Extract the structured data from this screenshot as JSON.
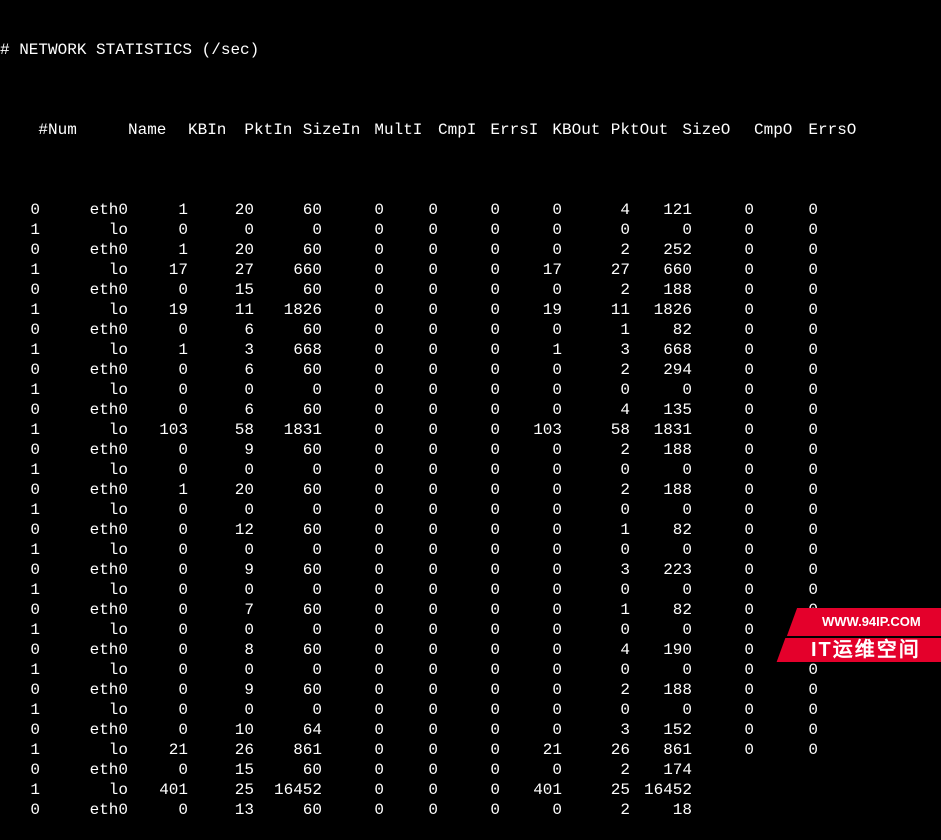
{
  "title": "# NETWORK STATISTICS (/sec)",
  "headers": {
    "num": "#Num",
    "name": "Name",
    "kbin": "KBIn",
    "pktin": "PktIn",
    "sizein": "SizeIn",
    "multi": "MultI",
    "cmpi": "CmpI",
    "errsi": "ErrsI",
    "kbout": "KBOut",
    "pktout": "PktOut",
    "sizeo": "SizeO",
    "cmpo": "CmpO",
    "errso": "ErrsO"
  },
  "rows": [
    {
      "num": "0",
      "name": "eth0",
      "kbin": "1",
      "pktin": "20",
      "sizein": "60",
      "multi": "0",
      "cmpi": "0",
      "errsi": "0",
      "kbout": "0",
      "pktout": "4",
      "sizeo": "121",
      "cmpo": "0",
      "errso": "0"
    },
    {
      "num": "1",
      "name": "lo",
      "kbin": "0",
      "pktin": "0",
      "sizein": "0",
      "multi": "0",
      "cmpi": "0",
      "errsi": "0",
      "kbout": "0",
      "pktout": "0",
      "sizeo": "0",
      "cmpo": "0",
      "errso": "0"
    },
    {
      "num": "0",
      "name": "eth0",
      "kbin": "1",
      "pktin": "20",
      "sizein": "60",
      "multi": "0",
      "cmpi": "0",
      "errsi": "0",
      "kbout": "0",
      "pktout": "2",
      "sizeo": "252",
      "cmpo": "0",
      "errso": "0"
    },
    {
      "num": "1",
      "name": "lo",
      "kbin": "17",
      "pktin": "27",
      "sizein": "660",
      "multi": "0",
      "cmpi": "0",
      "errsi": "0",
      "kbout": "17",
      "pktout": "27",
      "sizeo": "660",
      "cmpo": "0",
      "errso": "0"
    },
    {
      "num": "0",
      "name": "eth0",
      "kbin": "0",
      "pktin": "15",
      "sizein": "60",
      "multi": "0",
      "cmpi": "0",
      "errsi": "0",
      "kbout": "0",
      "pktout": "2",
      "sizeo": "188",
      "cmpo": "0",
      "errso": "0"
    },
    {
      "num": "1",
      "name": "lo",
      "kbin": "19",
      "pktin": "11",
      "sizein": "1826",
      "multi": "0",
      "cmpi": "0",
      "errsi": "0",
      "kbout": "19",
      "pktout": "11",
      "sizeo": "1826",
      "cmpo": "0",
      "errso": "0"
    },
    {
      "num": "0",
      "name": "eth0",
      "kbin": "0",
      "pktin": "6",
      "sizein": "60",
      "multi": "0",
      "cmpi": "0",
      "errsi": "0",
      "kbout": "0",
      "pktout": "1",
      "sizeo": "82",
      "cmpo": "0",
      "errso": "0"
    },
    {
      "num": "1",
      "name": "lo",
      "kbin": "1",
      "pktin": "3",
      "sizein": "668",
      "multi": "0",
      "cmpi": "0",
      "errsi": "0",
      "kbout": "1",
      "pktout": "3",
      "sizeo": "668",
      "cmpo": "0",
      "errso": "0"
    },
    {
      "num": "0",
      "name": "eth0",
      "kbin": "0",
      "pktin": "6",
      "sizein": "60",
      "multi": "0",
      "cmpi": "0",
      "errsi": "0",
      "kbout": "0",
      "pktout": "2",
      "sizeo": "294",
      "cmpo": "0",
      "errso": "0"
    },
    {
      "num": "1",
      "name": "lo",
      "kbin": "0",
      "pktin": "0",
      "sizein": "0",
      "multi": "0",
      "cmpi": "0",
      "errsi": "0",
      "kbout": "0",
      "pktout": "0",
      "sizeo": "0",
      "cmpo": "0",
      "errso": "0"
    },
    {
      "num": "0",
      "name": "eth0",
      "kbin": "0",
      "pktin": "6",
      "sizein": "60",
      "multi": "0",
      "cmpi": "0",
      "errsi": "0",
      "kbout": "0",
      "pktout": "4",
      "sizeo": "135",
      "cmpo": "0",
      "errso": "0"
    },
    {
      "num": "1",
      "name": "lo",
      "kbin": "103",
      "pktin": "58",
      "sizein": "1831",
      "multi": "0",
      "cmpi": "0",
      "errsi": "0",
      "kbout": "103",
      "pktout": "58",
      "sizeo": "1831",
      "cmpo": "0",
      "errso": "0"
    },
    {
      "num": "0",
      "name": "eth0",
      "kbin": "0",
      "pktin": "9",
      "sizein": "60",
      "multi": "0",
      "cmpi": "0",
      "errsi": "0",
      "kbout": "0",
      "pktout": "2",
      "sizeo": "188",
      "cmpo": "0",
      "errso": "0"
    },
    {
      "num": "1",
      "name": "lo",
      "kbin": "0",
      "pktin": "0",
      "sizein": "0",
      "multi": "0",
      "cmpi": "0",
      "errsi": "0",
      "kbout": "0",
      "pktout": "0",
      "sizeo": "0",
      "cmpo": "0",
      "errso": "0"
    },
    {
      "num": "0",
      "name": "eth0",
      "kbin": "1",
      "pktin": "20",
      "sizein": "60",
      "multi": "0",
      "cmpi": "0",
      "errsi": "0",
      "kbout": "0",
      "pktout": "2",
      "sizeo": "188",
      "cmpo": "0",
      "errso": "0"
    },
    {
      "num": "1",
      "name": "lo",
      "kbin": "0",
      "pktin": "0",
      "sizein": "0",
      "multi": "0",
      "cmpi": "0",
      "errsi": "0",
      "kbout": "0",
      "pktout": "0",
      "sizeo": "0",
      "cmpo": "0",
      "errso": "0"
    },
    {
      "num": "0",
      "name": "eth0",
      "kbin": "0",
      "pktin": "12",
      "sizein": "60",
      "multi": "0",
      "cmpi": "0",
      "errsi": "0",
      "kbout": "0",
      "pktout": "1",
      "sizeo": "82",
      "cmpo": "0",
      "errso": "0"
    },
    {
      "num": "1",
      "name": "lo",
      "kbin": "0",
      "pktin": "0",
      "sizein": "0",
      "multi": "0",
      "cmpi": "0",
      "errsi": "0",
      "kbout": "0",
      "pktout": "0",
      "sizeo": "0",
      "cmpo": "0",
      "errso": "0"
    },
    {
      "num": "0",
      "name": "eth0",
      "kbin": "0",
      "pktin": "9",
      "sizein": "60",
      "multi": "0",
      "cmpi": "0",
      "errsi": "0",
      "kbout": "0",
      "pktout": "3",
      "sizeo": "223",
      "cmpo": "0",
      "errso": "0"
    },
    {
      "num": "1",
      "name": "lo",
      "kbin": "0",
      "pktin": "0",
      "sizein": "0",
      "multi": "0",
      "cmpi": "0",
      "errsi": "0",
      "kbout": "0",
      "pktout": "0",
      "sizeo": "0",
      "cmpo": "0",
      "errso": "0"
    },
    {
      "num": "0",
      "name": "eth0",
      "kbin": "0",
      "pktin": "7",
      "sizein": "60",
      "multi": "0",
      "cmpi": "0",
      "errsi": "0",
      "kbout": "0",
      "pktout": "1",
      "sizeo": "82",
      "cmpo": "0",
      "errso": "0"
    },
    {
      "num": "1",
      "name": "lo",
      "kbin": "0",
      "pktin": "0",
      "sizein": "0",
      "multi": "0",
      "cmpi": "0",
      "errsi": "0",
      "kbout": "0",
      "pktout": "0",
      "sizeo": "0",
      "cmpo": "0",
      "errso": "0"
    },
    {
      "num": "0",
      "name": "eth0",
      "kbin": "0",
      "pktin": "8",
      "sizein": "60",
      "multi": "0",
      "cmpi": "0",
      "errsi": "0",
      "kbout": "0",
      "pktout": "4",
      "sizeo": "190",
      "cmpo": "0",
      "errso": "0"
    },
    {
      "num": "1",
      "name": "lo",
      "kbin": "0",
      "pktin": "0",
      "sizein": "0",
      "multi": "0",
      "cmpi": "0",
      "errsi": "0",
      "kbout": "0",
      "pktout": "0",
      "sizeo": "0",
      "cmpo": "0",
      "errso": "0"
    },
    {
      "num": "0",
      "name": "eth0",
      "kbin": "0",
      "pktin": "9",
      "sizein": "60",
      "multi": "0",
      "cmpi": "0",
      "errsi": "0",
      "kbout": "0",
      "pktout": "2",
      "sizeo": "188",
      "cmpo": "0",
      "errso": "0"
    },
    {
      "num": "1",
      "name": "lo",
      "kbin": "0",
      "pktin": "0",
      "sizein": "0",
      "multi": "0",
      "cmpi": "0",
      "errsi": "0",
      "kbout": "0",
      "pktout": "0",
      "sizeo": "0",
      "cmpo": "0",
      "errso": "0"
    },
    {
      "num": "0",
      "name": "eth0",
      "kbin": "0",
      "pktin": "10",
      "sizein": "64",
      "multi": "0",
      "cmpi": "0",
      "errsi": "0",
      "kbout": "0",
      "pktout": "3",
      "sizeo": "152",
      "cmpo": "0",
      "errso": "0"
    },
    {
      "num": "1",
      "name": "lo",
      "kbin": "21",
      "pktin": "26",
      "sizein": "861",
      "multi": "0",
      "cmpi": "0",
      "errsi": "0",
      "kbout": "21",
      "pktout": "26",
      "sizeo": "861",
      "cmpo": "0",
      "errso": "0"
    },
    {
      "num": "0",
      "name": "eth0",
      "kbin": "0",
      "pktin": "15",
      "sizein": "60",
      "multi": "0",
      "cmpi": "0",
      "errsi": "0",
      "kbout": "0",
      "pktout": "2",
      "sizeo": "174",
      "cmpo": "",
      "errso": ""
    },
    {
      "num": "1",
      "name": "lo",
      "kbin": "401",
      "pktin": "25",
      "sizein": "16452",
      "multi": "0",
      "cmpi": "0",
      "errsi": "0",
      "kbout": "401",
      "pktout": "25",
      "sizeo": "16452",
      "cmpo": "",
      "errso": ""
    },
    {
      "num": "0",
      "name": "eth0",
      "kbin": "0",
      "pktin": "13",
      "sizein": "60",
      "multi": "0",
      "cmpi": "0",
      "errsi": "0",
      "kbout": "0",
      "pktout": "2",
      "sizeo": "18",
      "cmpo": "",
      "errso": ""
    }
  ],
  "watermark": {
    "url": "WWW.94IP.COM",
    "label": "IT运维空间"
  }
}
